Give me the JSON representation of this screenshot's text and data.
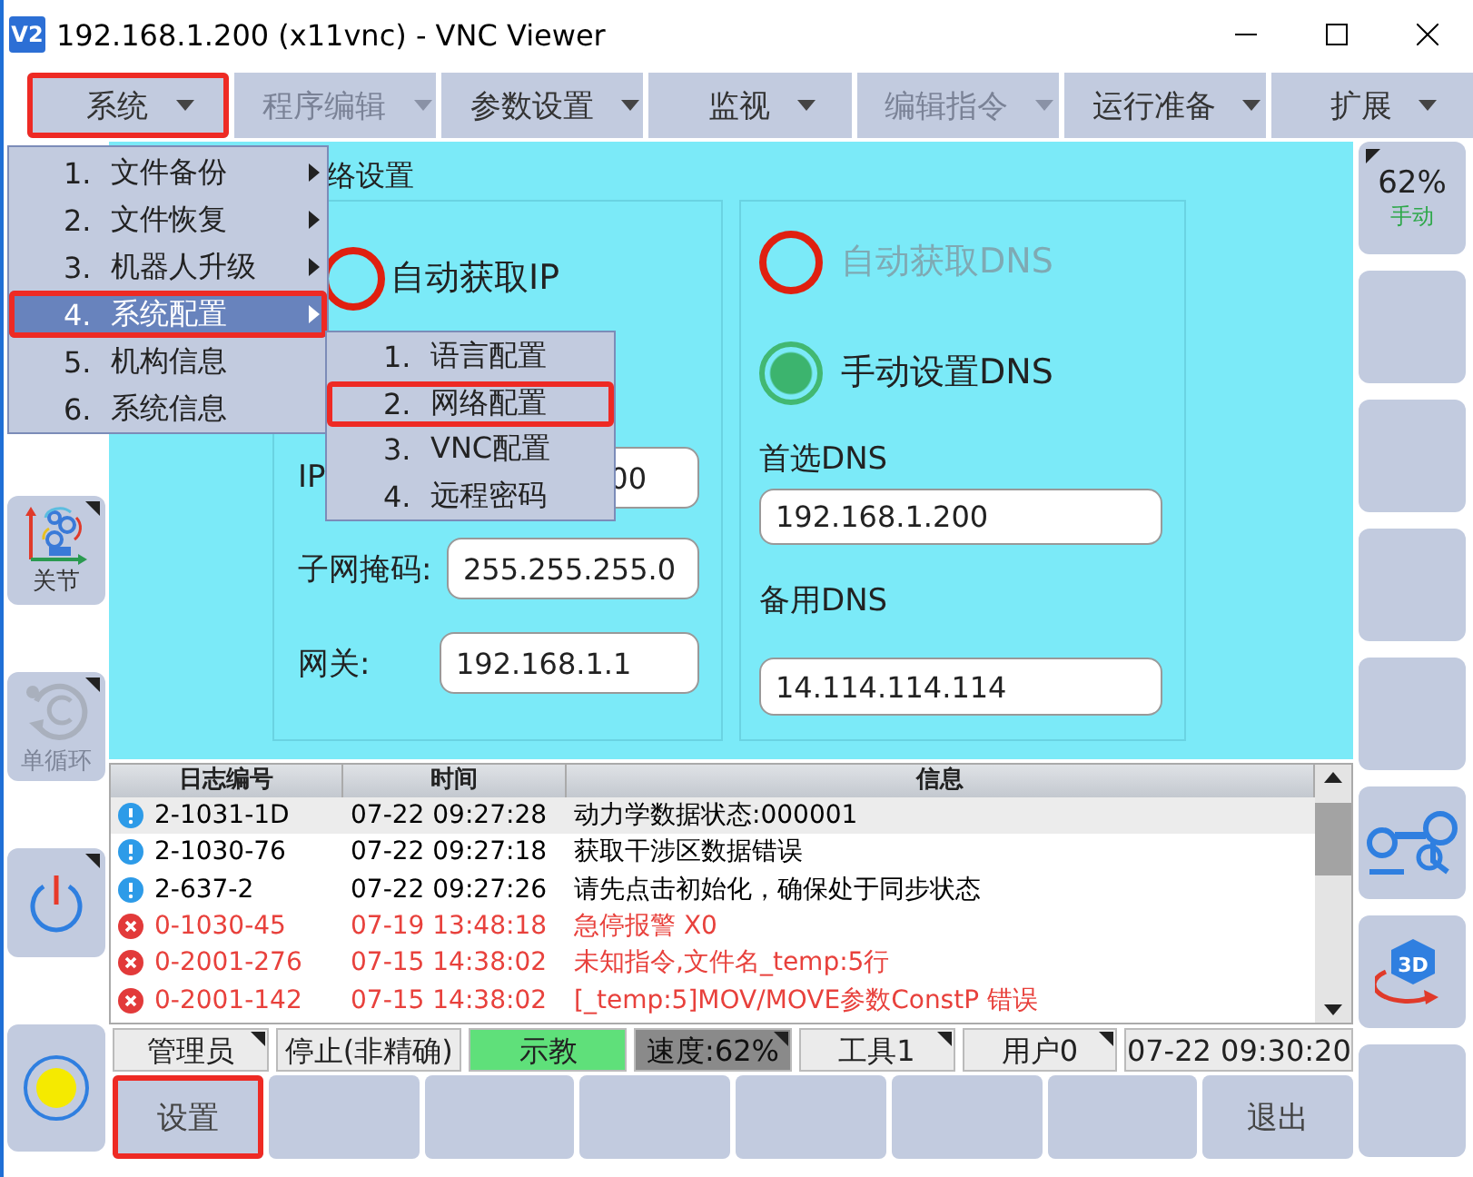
{
  "window": {
    "icon": "V2",
    "title": "192.168.1.200 (x11vnc) - VNC Viewer"
  },
  "menu_bar": [
    {
      "label": "系统",
      "disabled": false,
      "highlighted": true
    },
    {
      "label": "程序编辑",
      "disabled": true,
      "highlighted": false
    },
    {
      "label": "参数设置",
      "disabled": false,
      "highlighted": false
    },
    {
      "label": "监视",
      "disabled": false,
      "highlighted": false
    },
    {
      "label": "编辑指令",
      "disabled": true,
      "highlighted": false
    },
    {
      "label": "运行准备",
      "disabled": false,
      "highlighted": false
    },
    {
      "label": "扩展",
      "disabled": false,
      "highlighted": false
    }
  ],
  "system_menu": [
    {
      "number": "1.",
      "label": "文件备份",
      "submenu": true,
      "selected": false,
      "highlighted": false
    },
    {
      "number": "2.",
      "label": "文件恢复",
      "submenu": true,
      "selected": false,
      "highlighted": false
    },
    {
      "number": "3.",
      "label": "机器人升级",
      "submenu": true,
      "selected": false,
      "highlighted": false
    },
    {
      "number": "4.",
      "label": "系统配置",
      "submenu": true,
      "selected": true,
      "highlighted": true
    },
    {
      "number": "5.",
      "label": "机构信息",
      "submenu": false,
      "selected": false,
      "highlighted": false
    },
    {
      "number": "6.",
      "label": "系统信息",
      "submenu": false,
      "selected": false,
      "highlighted": false
    }
  ],
  "config_submenu": [
    {
      "number": "1.",
      "label": "语言配置",
      "highlighted": false
    },
    {
      "number": "2.",
      "label": "网络配置",
      "highlighted": true
    },
    {
      "number": "3.",
      "label": "VNC配置",
      "highlighted": false
    },
    {
      "number": "4.",
      "label": "远程密码",
      "highlighted": false
    }
  ],
  "left_toolbar": [
    {
      "kind": "joint",
      "label": "关节",
      "disabled": false
    },
    {
      "kind": "cycle",
      "label": "单循环",
      "disabled": true
    },
    {
      "kind": "power"
    },
    {
      "kind": "lamp"
    }
  ],
  "right_toolbar": [
    {
      "kind": "speed",
      "value": "62%",
      "mode": "手动"
    },
    {
      "kind": "blank"
    },
    {
      "kind": "blank"
    },
    {
      "kind": "blank"
    },
    {
      "kind": "blank"
    },
    {
      "kind": "robot"
    },
    {
      "kind": "view3d",
      "label": "3D"
    },
    {
      "kind": "blank"
    }
  ],
  "network_settings": {
    "title": "络设置",
    "ip_modes": [
      {
        "label": "自动获取IP",
        "selected": false
      }
    ],
    "ip_label": "IP",
    "ip_value": "00",
    "subnet_label": "子网掩码:",
    "subnet_value": "255.255.255.0",
    "gateway_label": "网关:",
    "gateway_value": "192.168.1.1",
    "dns_modes": [
      {
        "label": "自动获取DNS",
        "selected": false,
        "disabled": true
      },
      {
        "label": "手动设置DNS",
        "selected": true,
        "disabled": false
      }
    ],
    "dns1_label": "首选DNS",
    "dns1_value": "192.168.1.200",
    "dns2_label": "备用DNS",
    "dns2_value": "14.114.114.114"
  },
  "log": {
    "columns": [
      "日志编号",
      "时间",
      "信息"
    ],
    "rows": [
      {
        "kind": "info",
        "code": "2-1031-1D",
        "time": "07-22 09:27:28",
        "message": "动力学数据状态:000001",
        "selected": true
      },
      {
        "kind": "info",
        "code": "2-1030-76",
        "time": "07-22 09:27:18",
        "message": "获取干涉区数据错误",
        "selected": false
      },
      {
        "kind": "info",
        "code": "2-637-2",
        "time": "07-22 09:27:26",
        "message": "请先点击初始化，确保处于同步状态",
        "selected": false
      },
      {
        "kind": "error",
        "code": "0-1030-45",
        "time": "07-19 13:48:18",
        "message": "急停报警 X0",
        "selected": false
      },
      {
        "kind": "error",
        "code": "0-2001-276",
        "time": "07-15 14:38:02",
        "message": "未知指令,文件名_temp:5行",
        "selected": false
      },
      {
        "kind": "error",
        "code": "0-2001-142",
        "time": "07-15 14:38:02",
        "message": "[_temp:5]MOV/MOVE参数ConstP 错误",
        "selected": false
      }
    ]
  },
  "status_bar": [
    {
      "kind": "plain",
      "text": "管理员",
      "has_menu": true
    },
    {
      "kind": "plain",
      "text": "停止(非精确)",
      "has_menu": false
    },
    {
      "kind": "mode",
      "text": "示教",
      "has_menu": false
    },
    {
      "kind": "speed",
      "text": "速度:62%",
      "has_menu": true
    },
    {
      "kind": "plain",
      "text": "工具1",
      "has_menu": true
    },
    {
      "kind": "plain",
      "text": "用户0",
      "has_menu": true
    },
    {
      "kind": "plain",
      "text": "07-22 09:30:20",
      "has_menu": false
    }
  ],
  "bottom_buttons": [
    {
      "kind": "label",
      "label": "设置",
      "highlighted": true
    },
    {
      "kind": "blank",
      "highlighted": false
    },
    {
      "kind": "blank",
      "highlighted": false
    },
    {
      "kind": "blank",
      "highlighted": false
    },
    {
      "kind": "blank",
      "highlighted": false
    },
    {
      "kind": "blank",
      "highlighted": false
    },
    {
      "kind": "blank",
      "highlighted": false
    },
    {
      "kind": "label",
      "label": "退出",
      "highlighted": false
    }
  ]
}
